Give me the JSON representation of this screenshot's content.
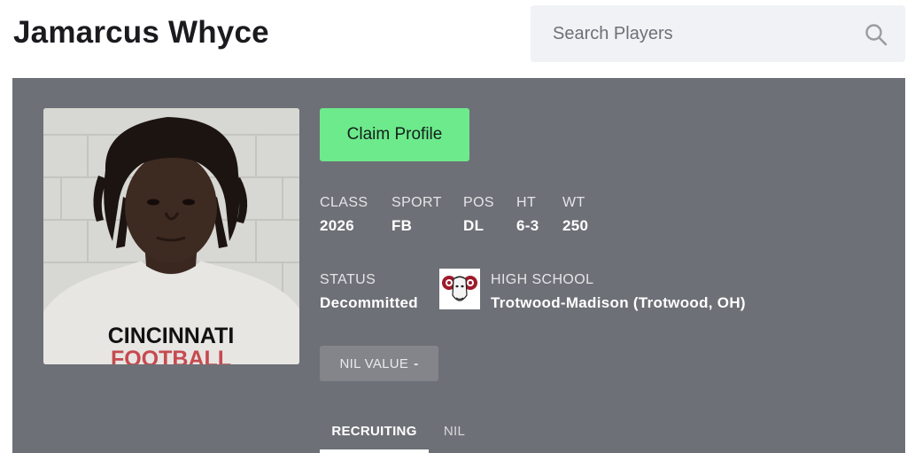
{
  "player": {
    "name": "Jamarcus Whyce",
    "photo_shirt_text_1": "CINCINNATI",
    "photo_shirt_text_2": "FOOTBALL"
  },
  "search": {
    "placeholder": "Search Players",
    "icon": "search-icon"
  },
  "profile": {
    "claim_label": "Claim Profile",
    "stats": [
      {
        "label": "CLASS",
        "value": "2026"
      },
      {
        "label": "SPORT",
        "value": "FB"
      },
      {
        "label": "POS",
        "value": "DL"
      },
      {
        "label": "HT",
        "value": "6-3"
      },
      {
        "label": "WT",
        "value": "250"
      }
    ],
    "status": {
      "label": "STATUS",
      "value": "Decommitted"
    },
    "high_school": {
      "label": "HIGH SCHOOL",
      "value": "Trotwood-Madison (Trotwood, OH)",
      "logo_icon": "ram-mascot-icon"
    },
    "nil": {
      "label": "NIL VALUE",
      "value": "-"
    }
  },
  "tabs": [
    {
      "label": "RECRUITING",
      "active": true
    },
    {
      "label": "NIL",
      "active": false
    }
  ],
  "colors": {
    "card_bg": "#6e7077",
    "claim_button": "#6dea8c",
    "search_bg": "#f1f2f5",
    "name_text": "#1b1b1f"
  }
}
